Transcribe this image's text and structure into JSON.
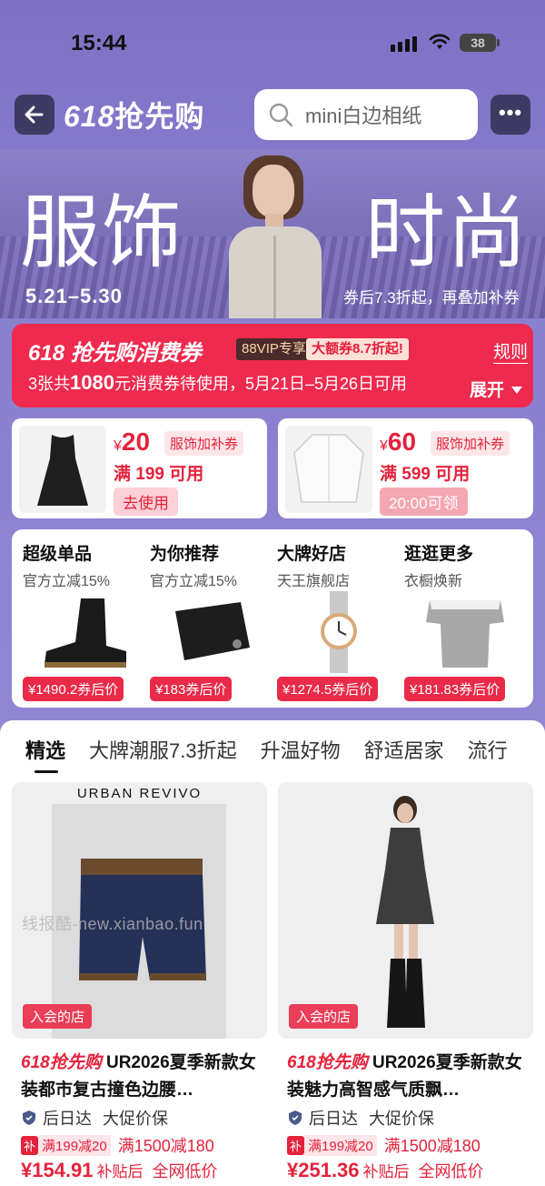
{
  "status_bar": {
    "time": "15:44",
    "battery": "38"
  },
  "header": {
    "brand_num": "618",
    "brand_text": "抢先购",
    "search_placeholder": "mini白边相纸"
  },
  "banner": {
    "title_left": "服饰",
    "title_right": "时尚",
    "date_range": "5.21–5.30",
    "subtitle": "券后7.3折起，再叠加补券"
  },
  "coupon_panel": {
    "title": "618 抢先购消费券",
    "tag_vip": "88VIP专享",
    "tag_big": "大额券8.7折起!",
    "line_prefix": "3张共",
    "line_amount": "1080",
    "line_suffix": "元消费券待使用，5月21日–5月26日可用",
    "rules_label": "规则",
    "expand_label": "展开"
  },
  "small_coupons": [
    {
      "currency": "¥",
      "amount": "20",
      "category": "服饰加补券",
      "condition": "满 199 可用",
      "action": "去使用"
    },
    {
      "currency": "¥",
      "amount": "60",
      "category": "服饰加补券",
      "condition": "满 599 可用",
      "action": "20:00可领"
    }
  ],
  "categories": [
    {
      "title": "超级单品",
      "subtitle": "官方立减15%",
      "price": "¥1490.2券后价",
      "icon": "boot-icon"
    },
    {
      "title": "为你推荐",
      "subtitle": "官方立减15%",
      "price": "¥183券后价",
      "icon": "wallet-icon"
    },
    {
      "title": "大牌好店",
      "subtitle": "天王旗舰店",
      "price": "¥1274.5券后价",
      "icon": "watch-icon"
    },
    {
      "title": "逛逛更多",
      "subtitle": "衣橱焕新",
      "price": "¥181.83券后价",
      "icon": "blouse-icon"
    }
  ],
  "feed_tabs": [
    "精选",
    "大牌潮服7.3折起",
    "升温好物",
    "舒适居家",
    "流行"
  ],
  "products": [
    {
      "brand_logo": "URBAN REVIVO",
      "store_badge": "入会的店",
      "tag": "618抢先购",
      "title": "UR2026夏季新款女装都市复古撞色边腰…",
      "ship": "后日达",
      "guarantee": "大促价保",
      "bu": "补",
      "promo1": "满199减20",
      "promo2": "满1500减180",
      "price": "¥154.91",
      "price_note": "补贴后",
      "low": "全网低价"
    },
    {
      "brand_logo": "",
      "store_badge": "入会的店",
      "tag": "618抢先购",
      "title": "UR2026夏季新款女装魅力高智感气质飘…",
      "ship": "后日达",
      "guarantee": "大促价保",
      "bu": "补",
      "promo1": "满199减20",
      "promo2": "满1500减180",
      "price": "¥251.36",
      "price_note": "补贴后",
      "low": "全网低价"
    }
  ],
  "watermark": "线报酷-new.xianbao.fun",
  "colors": {
    "accent_red": "#e5223c",
    "bg_purple": "#8a7fd0",
    "dark_btn": "#3d3a63"
  }
}
